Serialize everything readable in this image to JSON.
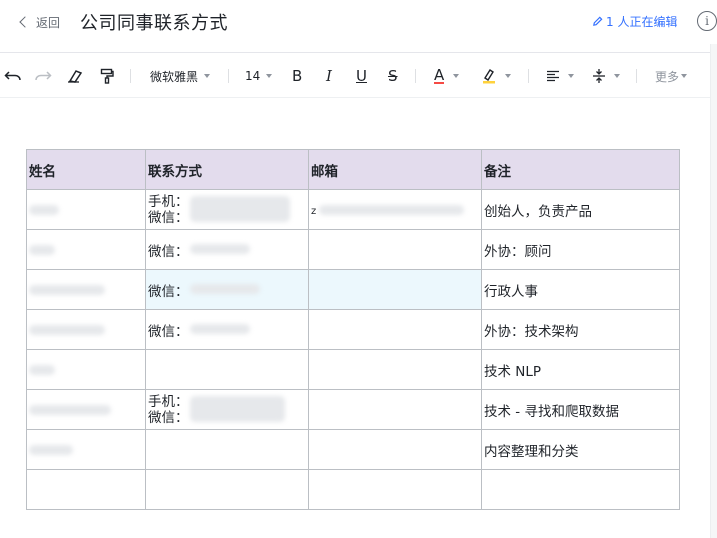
{
  "header": {
    "back_label": "返回",
    "title": "公司同事联系方式",
    "editing_status": "1 人正在编辑"
  },
  "toolbar": {
    "font_family": "微软雅黑",
    "font_size": "14",
    "bold": "B",
    "italic": "I",
    "underline": "U",
    "strike": "S",
    "font_color": "A",
    "more": "更多"
  },
  "table": {
    "headers": [
      "姓名",
      "联系方式",
      "邮箱",
      "备注"
    ],
    "rows": [
      {
        "contact": [
          "手机：",
          "微信："
        ],
        "email_prefix": "z",
        "note": "创始人，负责产品"
      },
      {
        "contact": [
          "微信："
        ],
        "email_prefix": "",
        "note": "外协：顾问"
      },
      {
        "contact": [
          "微信："
        ],
        "email_prefix": "",
        "note": "行政人事"
      },
      {
        "contact": [
          "微信："
        ],
        "email_prefix": "",
        "note": "外协：技术架构"
      },
      {
        "contact": [],
        "email_prefix": "",
        "note": "技术 NLP"
      },
      {
        "contact": [
          "手机：",
          "微信："
        ],
        "email_prefix": "",
        "note": "技术 - 寻找和爬取数据"
      },
      {
        "contact": [],
        "email_prefix": "",
        "note": "内容整理和分类"
      },
      {
        "contact": [],
        "email_prefix": "",
        "note": ""
      }
    ]
  },
  "colors": {
    "accent": "#3370ff",
    "header_row_bg": "#e3dced",
    "selected_cell_bg": "#ecf8fd",
    "font_color_underline": "#f54a45",
    "highlight_underline": "#ffd23c"
  },
  "icons": {
    "undo": "undo-icon",
    "redo": "redo-icon",
    "eraser": "eraser-icon",
    "format_painter": "format-painter-icon",
    "align": "align-icon",
    "line_spacing": "line-spacing-icon",
    "highlighter": "highlighter-icon",
    "info": "info-icon",
    "pencil": "pencil-icon"
  }
}
